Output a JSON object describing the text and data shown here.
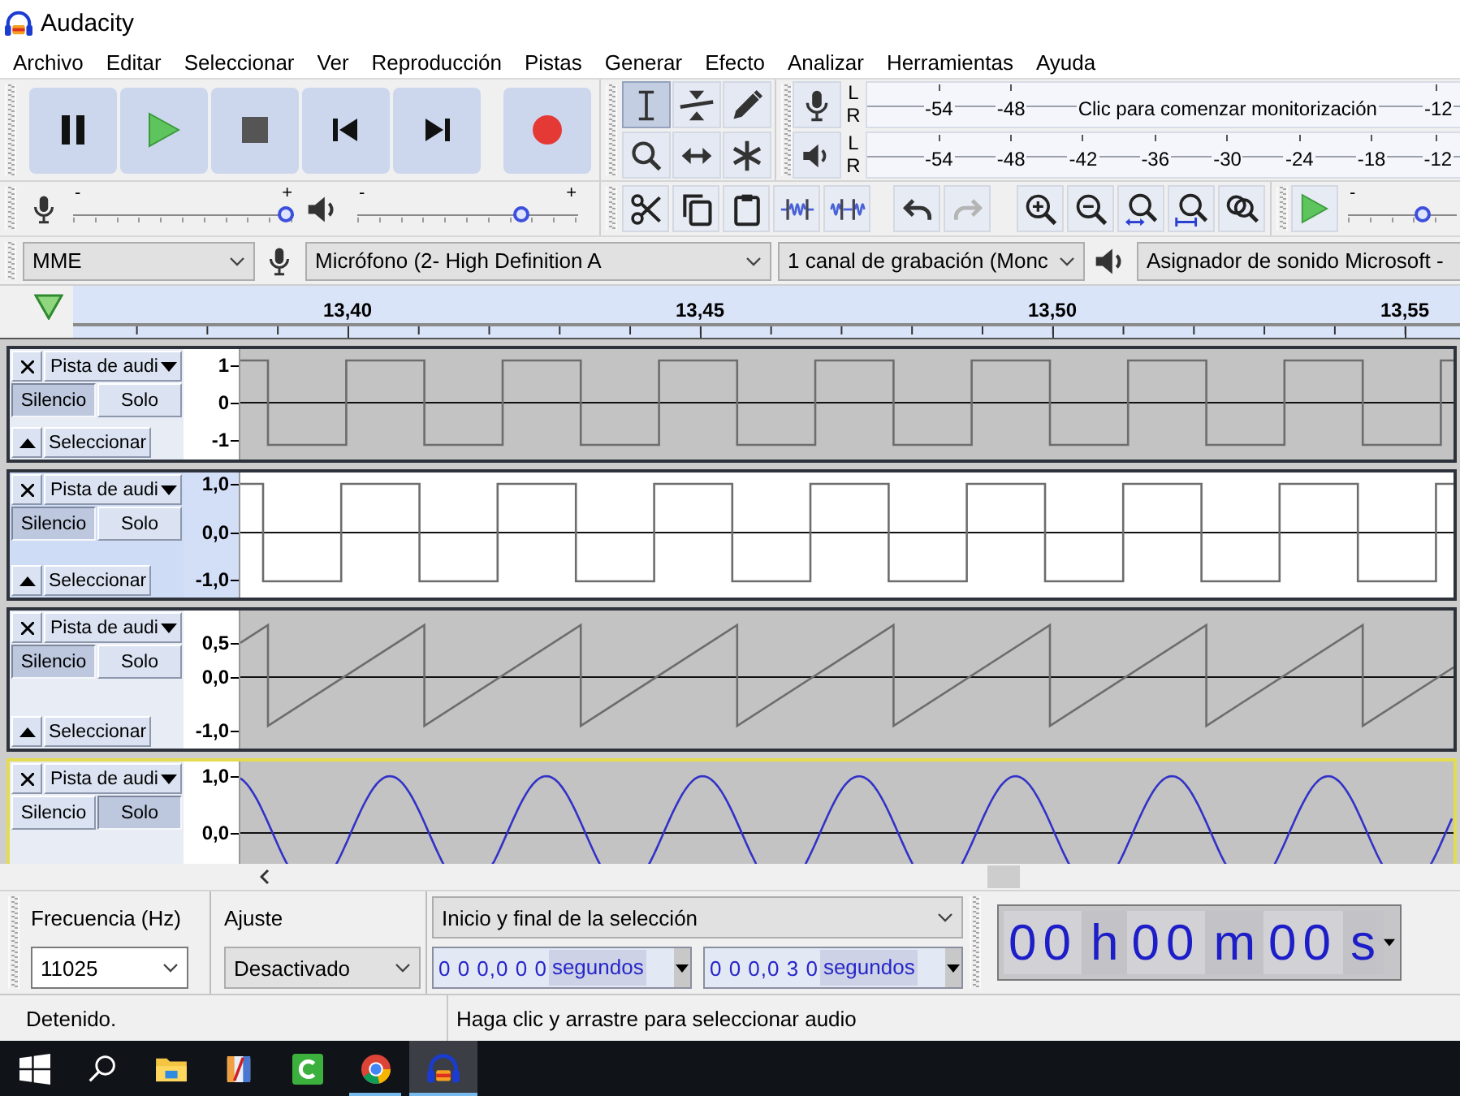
{
  "window": {
    "title": "Audacity"
  },
  "menu": [
    "Archivo",
    "Editar",
    "Seleccionar",
    "Ver",
    "Reproducción",
    "Pistas",
    "Generar",
    "Efecto",
    "Analizar",
    "Herramientas",
    "Ayuda"
  ],
  "tools": [
    {
      "selected": true
    },
    {
      "selected": false
    },
    {
      "selected": false
    },
    {
      "selected": false
    },
    {
      "selected": false
    },
    {
      "selected": false
    }
  ],
  "record_meter": {
    "channels": [
      "L",
      "R"
    ],
    "ticks": [
      "-54",
      "-48"
    ],
    "message": "Clic para comenzar monitorización",
    "end_ticks": [
      "-12"
    ]
  },
  "playback_meter": {
    "channels": [
      "L",
      "R"
    ],
    "ticks": [
      "-54",
      "-48",
      "-42",
      "-36",
      "-30",
      "-24",
      "-18",
      "-12"
    ]
  },
  "mixer": {
    "record_volume": {
      "min_label": "-",
      "max_label": "+",
      "level": 1
    },
    "playback_volume": {
      "min_label": "-",
      "max_label": "+",
      "level": 0.76
    }
  },
  "history_buttons": [
    {
      "disabled": false
    },
    {
      "disabled": true
    }
  ],
  "play_at_speed": {
    "min_label": "-",
    "level": 0.72
  },
  "devices": {
    "host": "MME",
    "input": "Micrófono (2- High Definition A",
    "channels": "1 canal de grabación (Monc",
    "output": "Asignador de sonido Microsoft -"
  },
  "timeline": {
    "labels": [
      "13,40",
      "13,45",
      "13,50",
      "13,55"
    ]
  },
  "tracks": [
    {
      "name": "Pista de audi",
      "mute_label": "Silencio",
      "solo_label": "Solo",
      "select_label": "Seleccionar",
      "muted": true,
      "solo": false,
      "selected": false,
      "focused": false,
      "kind": "square",
      "scale": [
        "1",
        "0",
        "-1"
      ]
    },
    {
      "name": "Pista de audi",
      "mute_label": "Silencio",
      "solo_label": "Solo",
      "select_label": "Seleccionar",
      "muted": true,
      "solo": false,
      "selected": true,
      "focused": false,
      "kind": "square",
      "scale": [
        "1,0",
        "0,0",
        "-1,0"
      ]
    },
    {
      "name": "Pista de audi",
      "mute_label": "Silencio",
      "solo_label": "Solo",
      "select_label": "Seleccionar",
      "muted": true,
      "solo": false,
      "selected": false,
      "focused": false,
      "kind": "sawtooth",
      "scale": [
        "0,5",
        "0,0",
        "-1,0"
      ]
    },
    {
      "name": "Pista de audi",
      "mute_label": "Silencio",
      "solo_label": "Solo",
      "muted": false,
      "solo": true,
      "selected": false,
      "focused": true,
      "kind": "sine",
      "scale": [
        "1,0",
        "0,0"
      ]
    }
  ],
  "selection_toolbar": {
    "rate_label": "Frecuencia (Hz)",
    "rate": "11025",
    "snap_label": "Ajuste",
    "snap": "Desactivado",
    "mode": "Inicio y final de la selección",
    "start": {
      "digits": "0 0 0,0 0 0",
      "unit": "segundos"
    },
    "end": {
      "digits": "0 0 0,0 3 0",
      "unit": "segundos"
    }
  },
  "time_display": {
    "parts": [
      {
        "value": "00",
        "unit": "h"
      },
      {
        "value": "00",
        "unit": "m"
      },
      {
        "value": "00",
        "unit": "s"
      }
    ]
  },
  "status_bar": {
    "state": "Detenido.",
    "hint": "Haga clic y arrastre para seleccionar audio"
  },
  "taskbar": {
    "apps": [
      {
        "running": false,
        "selected": false
      },
      {
        "running": false,
        "selected": false
      },
      {
        "running": false,
        "selected": false
      },
      {
        "running": true,
        "selected": false
      },
      {
        "running": true,
        "selected": true
      }
    ]
  }
}
